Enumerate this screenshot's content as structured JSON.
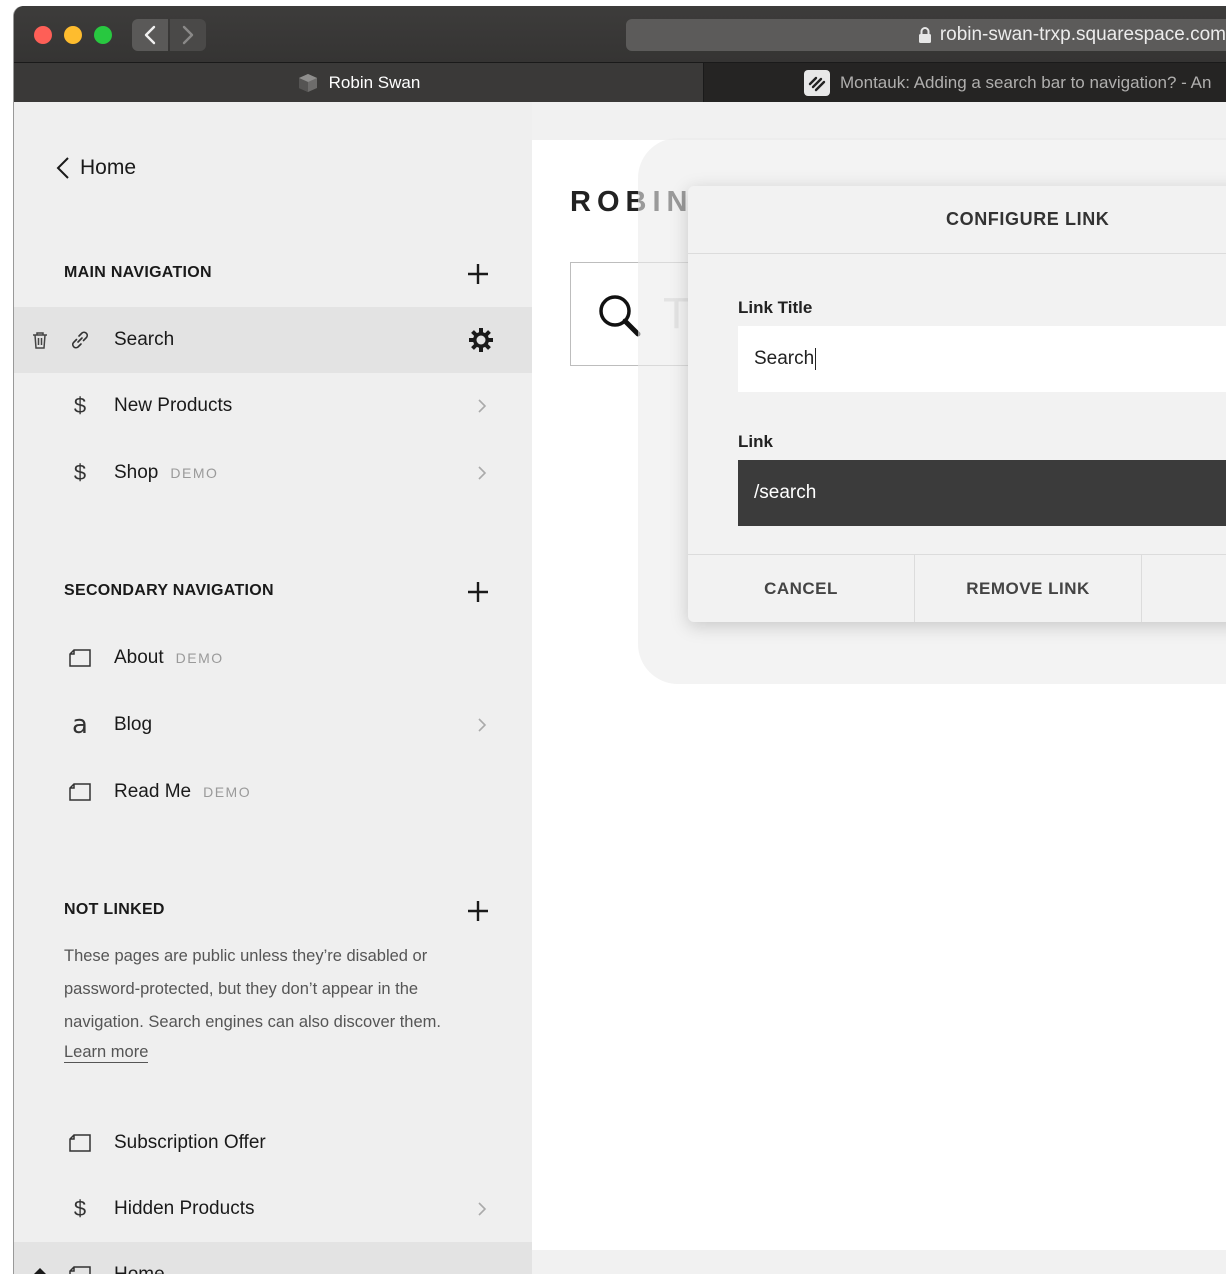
{
  "browser": {
    "url": "robin-swan-trxp.squarespace.com",
    "tabs": [
      {
        "label": "Robin Swan"
      },
      {
        "label": "Montauk: Adding a search bar to navigation? - An"
      }
    ]
  },
  "sidebar": {
    "home_label": "Home",
    "main_nav": {
      "title": "MAIN NAVIGATION",
      "items": [
        {
          "label": "Search",
          "icon": "link-icon",
          "badge": ""
        },
        {
          "label": "New Products",
          "icon": "dollar-icon",
          "badge": ""
        },
        {
          "label": "Shop",
          "icon": "dollar-icon",
          "badge": "DEMO"
        }
      ]
    },
    "secondary_nav": {
      "title": "SECONDARY NAVIGATION",
      "items": [
        {
          "label": "About",
          "icon": "page-icon",
          "badge": "DEMO"
        },
        {
          "label": "Blog",
          "icon": "blog-icon",
          "badge": ""
        },
        {
          "label": "Read Me",
          "icon": "page-icon",
          "badge": "DEMO"
        }
      ]
    },
    "not_linked": {
      "title": "NOT LINKED",
      "description": "These pages are public unless they’re disabled or password-protected, but they don’t appear in the navigation. Search engines can also discover them.",
      "learn_more": "Learn more",
      "items": [
        {
          "label": "Subscription Offer",
          "icon": "page-icon"
        },
        {
          "label": "Hidden Products",
          "icon": "dollar-icon"
        },
        {
          "label": "Home",
          "icon": "page-icon"
        }
      ]
    }
  },
  "preview": {
    "site_title": "ROBIN SWAN",
    "search_placeholder": "Ty"
  },
  "modal": {
    "title": "CONFIGURE LINK",
    "link_title_label": "Link Title",
    "link_title_value": "Search",
    "link_label": "Link",
    "link_value": "/search",
    "cancel": "CANCEL",
    "remove": "REMOVE LINK"
  }
}
